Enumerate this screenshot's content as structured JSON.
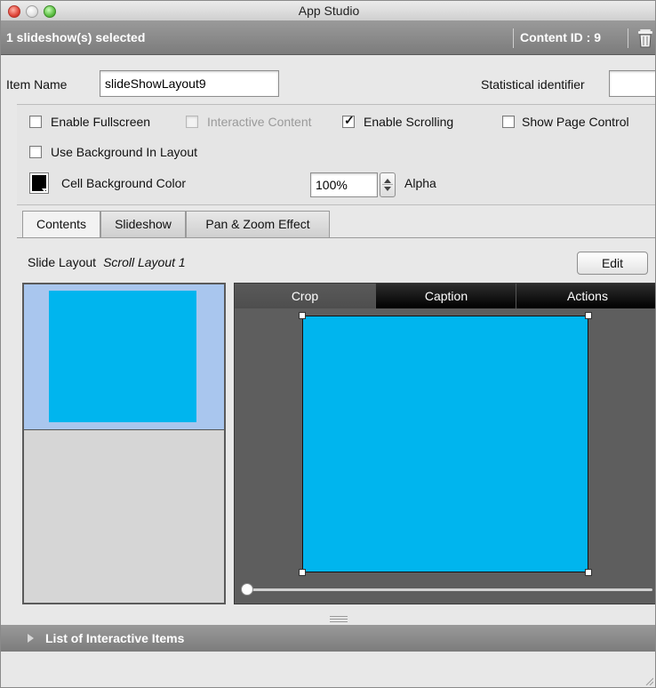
{
  "window": {
    "title": "App Studio"
  },
  "selection": {
    "label": "1 slideshow(s) selected",
    "content_id": "Content ID : 9"
  },
  "item": {
    "name_label": "Item Name",
    "name_value": "slideShowLayout9",
    "stat_label": "Statistical identifier",
    "stat_value": ""
  },
  "options": {
    "enable_fullscreen": {
      "label": "Enable Fullscreen",
      "checked": false
    },
    "interactive_content": {
      "label": "Interactive Content",
      "checked": false,
      "disabled": true
    },
    "enable_scrolling": {
      "label": "Enable Scrolling",
      "checked": true
    },
    "show_page_control": {
      "label": "Show Page Control",
      "checked": false
    },
    "use_background": {
      "label": "Use Background In Layout",
      "checked": false
    },
    "cell_bg_label": "Cell Background Color",
    "cell_bg_color": "#000000",
    "alpha_value": "100%",
    "alpha_label": "Alpha"
  },
  "tabs": [
    "Contents",
    "Slideshow",
    "Pan & Zoom Effect"
  ],
  "slide_layout": {
    "label": "Slide Layout",
    "value": "Scroll Layout 1"
  },
  "edit_button": "Edit",
  "preview_tabs": [
    "Crop",
    "Caption",
    "Actions"
  ],
  "colors": {
    "slide": "#00b5ee",
    "selected_row": "#a9c6ee"
  },
  "list_section": "List of Interactive Items"
}
